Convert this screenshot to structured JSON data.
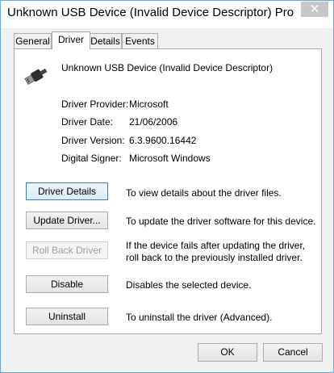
{
  "window": {
    "title": "Unknown USB Device (Invalid Device Descriptor) Pro...",
    "close_glyph": "✕"
  },
  "tabs": [
    {
      "label": "General",
      "active": false
    },
    {
      "label": "Driver",
      "active": true
    },
    {
      "label": "Details",
      "active": false
    },
    {
      "label": "Events",
      "active": false
    }
  ],
  "device": {
    "name": "Unknown USB Device (Invalid Device Descriptor)",
    "icon": "usb-connector-icon"
  },
  "info": [
    {
      "label": "Driver Provider:",
      "value": "Microsoft"
    },
    {
      "label": "Driver Date:",
      "value": "21/06/2006"
    },
    {
      "label": "Driver Version:",
      "value": "6.3.9600.16442"
    },
    {
      "label": "Digital Signer:",
      "value": "Microsoft Windows"
    }
  ],
  "actions": [
    {
      "label": "Driver Details",
      "description": "To view details about the driver files.",
      "enabled": true
    },
    {
      "label": "Update Driver...",
      "description": "To update the driver software for this device.",
      "enabled": true
    },
    {
      "label": "Roll Back Driver",
      "description": "If the device fails after updating the driver, roll back to the previously installed driver.",
      "enabled": false
    },
    {
      "label": "Disable",
      "description": "Disables the selected device.",
      "enabled": true
    },
    {
      "label": "Uninstall",
      "description": "To uninstall the driver (Advanced).",
      "enabled": true
    }
  ],
  "footer": {
    "ok_label": "OK",
    "cancel_label": "Cancel"
  },
  "colors": {
    "window_border": "#6fa6d8",
    "close_button": "#c7c7c7",
    "dialog_bg": "#f0f0f0"
  }
}
